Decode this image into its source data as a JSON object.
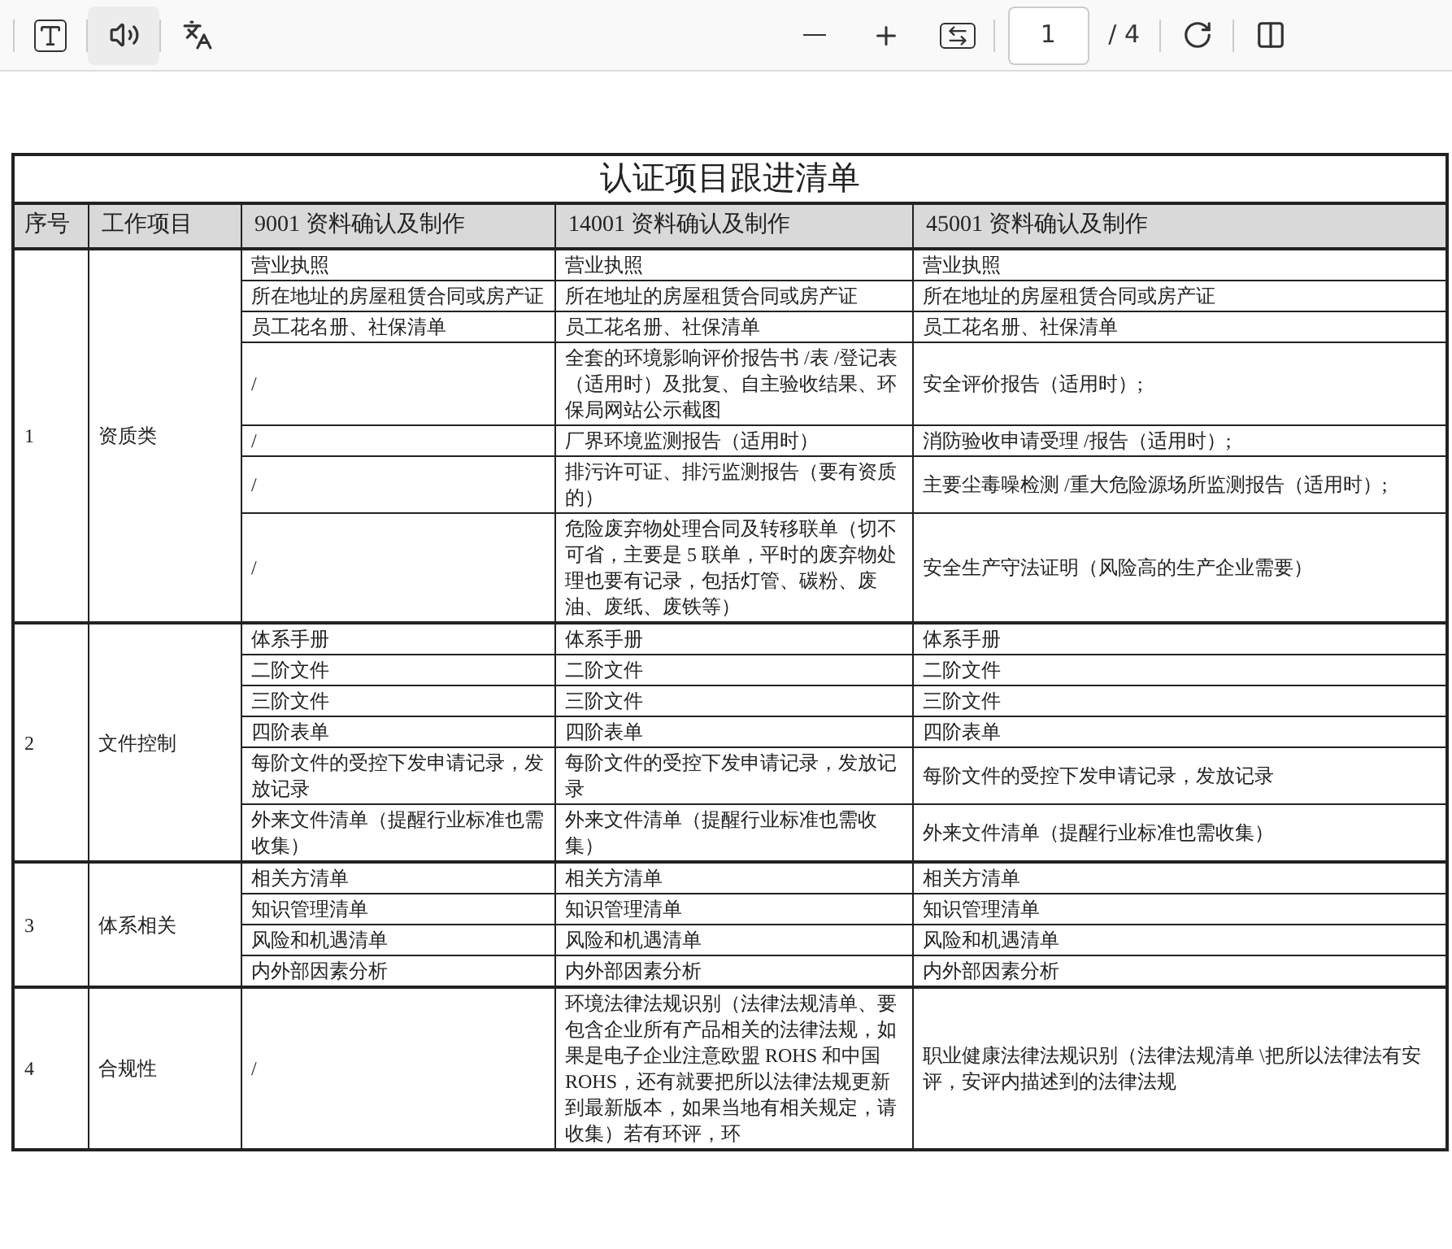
{
  "toolbar": {
    "page_number": "1",
    "page_total": "/ 4"
  },
  "document": {
    "title": "认证项目跟进清单",
    "columns": [
      "序号",
      "工作项目",
      "9001 资料确认及制作",
      "14001 资料确认及制作",
      "45001 资料确认及制作"
    ],
    "sections": [
      {
        "no": "1",
        "category": "资质类",
        "rows": [
          [
            "营业执照",
            "营业执照",
            "营业执照"
          ],
          [
            "所在地址的房屋租赁合同或房产证",
            "所在地址的房屋租赁合同或房产证",
            "所在地址的房屋租赁合同或房产证"
          ],
          [
            "员工花名册、社保清单",
            "员工花名册、社保清单",
            "员工花名册、社保清单"
          ],
          [
            "/",
            "全套的环境影响评价报告书 /表 /登记表（适用时）及批复、自主验收结果、环保局网站公示截图",
            "安全评价报告（适用时）;"
          ],
          [
            "/",
            "厂界环境监测报告（适用时）",
            "消防验收申请受理 /报告（适用时）;"
          ],
          [
            "/",
            "排污许可证、排污监测报告（要有资质的）",
            "主要尘毒噪检测 /重大危险源场所监测报告（适用时）;"
          ],
          [
            "/",
            "危险废弃物处理合同及转移联单（切不可省，主要是 5 联单，平时的废弃物处理也要有记录，包括灯管、碳粉、废油、废纸、废铁等）",
            "安全生产守法证明（风险高的生产企业需要）"
          ]
        ]
      },
      {
        "no": "2",
        "category": "文件控制",
        "rows": [
          [
            "体系手册",
            "体系手册",
            "体系手册"
          ],
          [
            "二阶文件",
            "二阶文件",
            "二阶文件"
          ],
          [
            "三阶文件",
            "三阶文件",
            "三阶文件"
          ],
          [
            "四阶表单",
            "四阶表单",
            "四阶表单"
          ],
          [
            "每阶文件的受控下发申请记录，发放记录",
            "每阶文件的受控下发申请记录，发放记录",
            "每阶文件的受控下发申请记录，发放记录"
          ],
          [
            "外来文件清单（提醒行业标准也需收集）",
            "外来文件清单（提醒行业标准也需收集）",
            "外来文件清单（提醒行业标准也需收集）"
          ]
        ]
      },
      {
        "no": "3",
        "category": "体系相关",
        "rows": [
          [
            "相关方清单",
            "相关方清单",
            "相关方清单"
          ],
          [
            "知识管理清单",
            "知识管理清单",
            "知识管理清单"
          ],
          [
            "风险和机遇清单",
            "风险和机遇清单",
            "风险和机遇清单"
          ],
          [
            "内外部因素分析",
            "内外部因素分析",
            "内外部因素分析"
          ]
        ]
      },
      {
        "no": "4",
        "category": "合规性",
        "rows": [
          [
            "/",
            "环境法律法规识别（法律法规清单、要包含企业所有产品相关的法律法规，如果是电子企业注意欧盟 ROHS 和中国 ROHS，还有就要把所以法律法规更新到最新版本，如果当地有相关规定，请收集）若有环评，环",
            "职业健康法律法规识别（法律法规清单 \\把所以法律法有安评，安评内描述到的法律法规"
          ]
        ]
      }
    ]
  }
}
